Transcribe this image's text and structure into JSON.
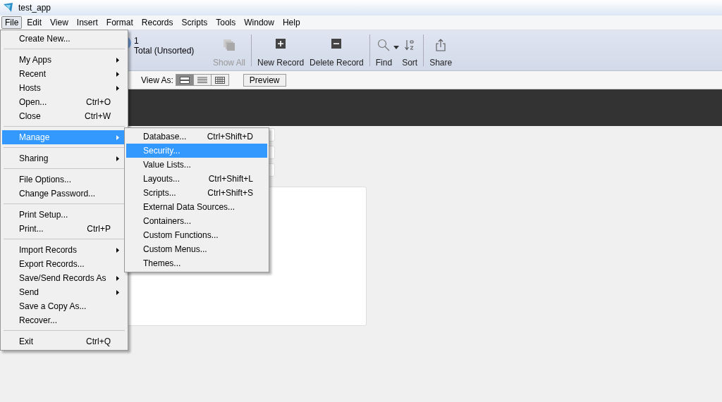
{
  "window": {
    "title": "test_app"
  },
  "menu_bar": [
    {
      "label": "File",
      "selected": true
    },
    {
      "label": "Edit",
      "selected": false
    },
    {
      "label": "View",
      "selected": false
    },
    {
      "label": "Insert",
      "selected": false
    },
    {
      "label": "Format",
      "selected": false
    },
    {
      "label": "Records",
      "selected": false
    },
    {
      "label": "Scripts",
      "selected": false
    },
    {
      "label": "Tools",
      "selected": false
    },
    {
      "label": "Window",
      "selected": false
    },
    {
      "label": "Help",
      "selected": false
    }
  ],
  "toolbar": {
    "record_number": "1",
    "record_status": "Total (Unsorted)",
    "buttons": [
      {
        "kind": "show-all",
        "label": "Show All",
        "disabled": true
      },
      {
        "kind": "new",
        "label": "New Record",
        "disabled": false
      },
      {
        "kind": "delete",
        "label": "Delete Record",
        "disabled": false
      },
      {
        "kind": "find",
        "label": "Find",
        "disabled": false
      },
      {
        "kind": "sort",
        "label": "Sort",
        "disabled": false
      },
      {
        "kind": "share",
        "label": "Share",
        "disabled": false
      }
    ]
  },
  "layout_bar": {
    "view_as_label": "View As:",
    "views": [
      {
        "kind": "form",
        "selected": true
      },
      {
        "kind": "list",
        "selected": false
      },
      {
        "kind": "table",
        "selected": false
      }
    ],
    "preview_button": "Preview"
  },
  "file_menu": [
    {
      "kind": "item",
      "label": "Create New...",
      "submenu": false,
      "selected": false
    },
    {
      "kind": "separator"
    },
    {
      "kind": "item",
      "label": "My Apps",
      "submenu": true,
      "selected": false
    },
    {
      "kind": "item",
      "label": "Recent",
      "submenu": true,
      "selected": false
    },
    {
      "kind": "item",
      "label": "Hosts",
      "submenu": true,
      "selected": false
    },
    {
      "kind": "item",
      "label": "Open...",
      "shortcut": "Ctrl+O",
      "submenu": false,
      "selected": false
    },
    {
      "kind": "item",
      "label": "Close",
      "shortcut": "Ctrl+W",
      "submenu": false,
      "selected": false
    },
    {
      "kind": "separator"
    },
    {
      "kind": "item",
      "label": "Manage",
      "submenu": true,
      "selected": true
    },
    {
      "kind": "separator"
    },
    {
      "kind": "item",
      "label": "Sharing",
      "submenu": true,
      "selected": false
    },
    {
      "kind": "separator"
    },
    {
      "kind": "item",
      "label": "File Options...",
      "submenu": false,
      "selected": false
    },
    {
      "kind": "item",
      "label": "Change Password...",
      "submenu": false,
      "selected": false
    },
    {
      "kind": "separator"
    },
    {
      "kind": "item",
      "label": "Print Setup...",
      "submenu": false,
      "selected": false
    },
    {
      "kind": "item",
      "label": "Print...",
      "shortcut": "Ctrl+P",
      "submenu": false,
      "selected": false
    },
    {
      "kind": "separator"
    },
    {
      "kind": "item",
      "label": "Import Records",
      "submenu": true,
      "selected": false
    },
    {
      "kind": "item",
      "label": "Export Records...",
      "submenu": false,
      "selected": false
    },
    {
      "kind": "item",
      "label": "Save/Send Records As",
      "submenu": true,
      "selected": false
    },
    {
      "kind": "item",
      "label": "Send",
      "submenu": true,
      "selected": false
    },
    {
      "kind": "item",
      "label": "Save a Copy As...",
      "submenu": false,
      "selected": false
    },
    {
      "kind": "item",
      "label": "Recover...",
      "submenu": false,
      "selected": false
    },
    {
      "kind": "separator"
    },
    {
      "kind": "item",
      "label": "Exit",
      "shortcut": "Ctrl+Q",
      "submenu": false,
      "selected": false
    }
  ],
  "manage_submenu": [
    {
      "label": "Database...",
      "shortcut": "Ctrl+Shift+D",
      "selected": false
    },
    {
      "label": "Security...",
      "selected": true
    },
    {
      "label": "Value Lists...",
      "selected": false
    },
    {
      "label": "Layouts...",
      "shortcut": "Ctrl+Shift+L",
      "selected": false
    },
    {
      "label": "Scripts...",
      "shortcut": "Ctrl+Shift+S",
      "selected": false
    },
    {
      "label": "External Data Sources...",
      "selected": false
    },
    {
      "label": "Containers...",
      "selected": false
    },
    {
      "label": "Custom Functions...",
      "selected": false
    },
    {
      "label": "Custom Menus...",
      "selected": false
    },
    {
      "label": "Themes...",
      "selected": false
    }
  ]
}
